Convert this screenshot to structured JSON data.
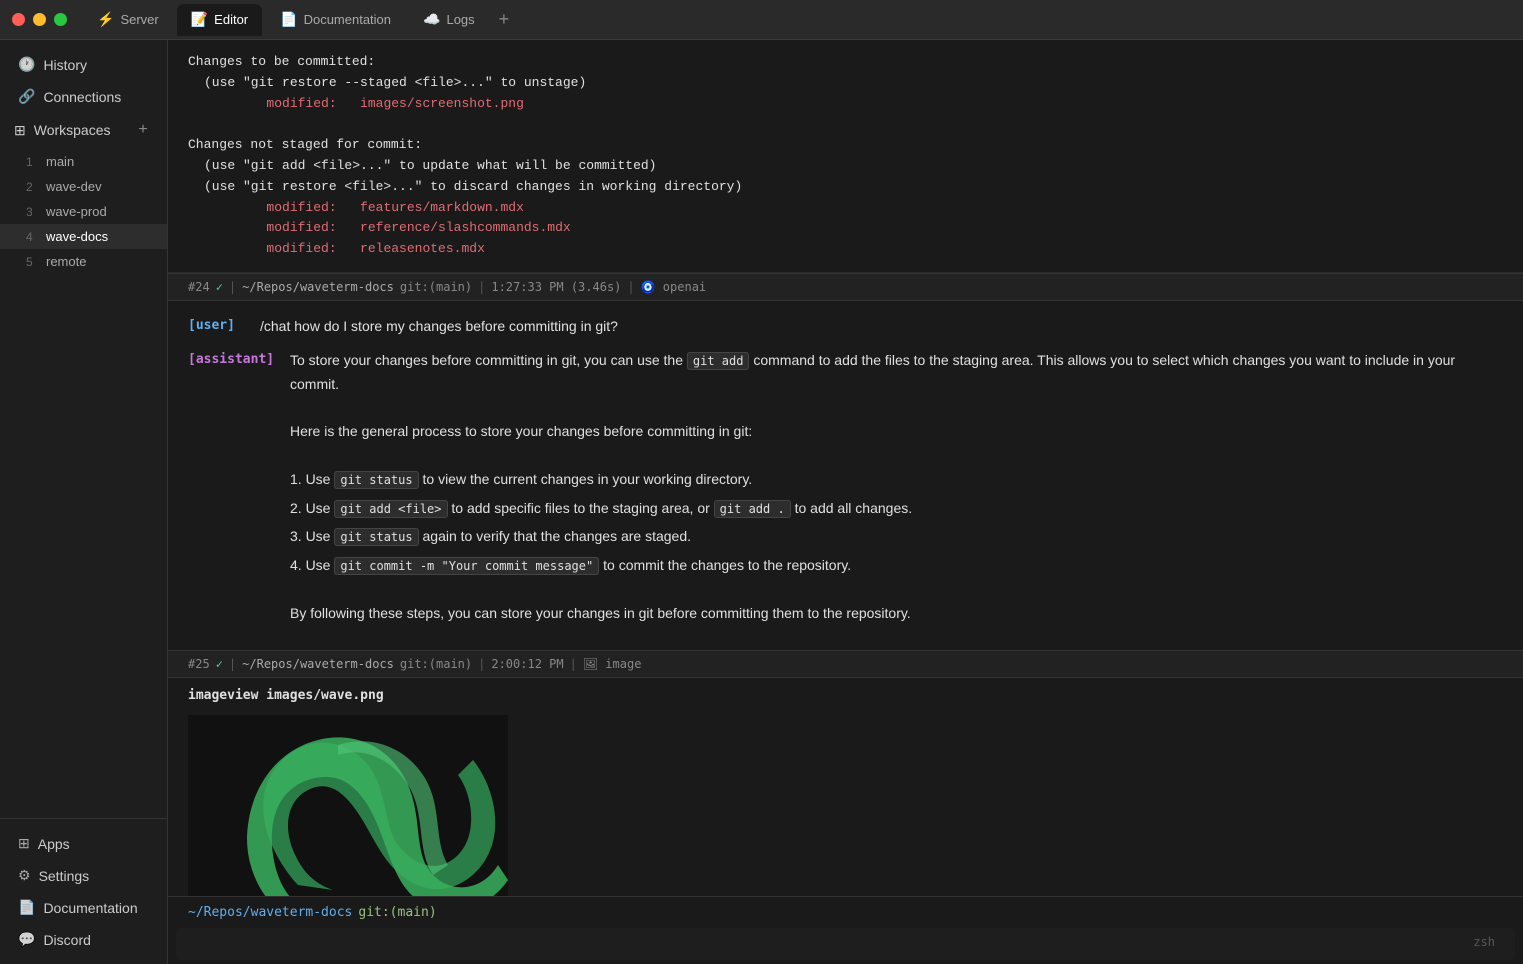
{
  "titlebar": {
    "tabs": [
      {
        "id": "server",
        "label": "Server",
        "icon": "⚡",
        "active": false
      },
      {
        "id": "editor",
        "label": "Editor",
        "icon": "📝",
        "active": true
      },
      {
        "id": "documentation",
        "label": "Documentation",
        "icon": "📄",
        "active": false
      },
      {
        "id": "logs",
        "label": "Logs",
        "icon": "☁️",
        "active": false
      }
    ],
    "add_tab": "+"
  },
  "sidebar": {
    "history_label": "History",
    "connections_label": "Connections",
    "workspaces_label": "Workspaces",
    "workspace_entries": [
      {
        "num": "1",
        "name": "main"
      },
      {
        "num": "2",
        "name": "wave-dev"
      },
      {
        "num": "3",
        "name": "wave-prod"
      },
      {
        "num": "4",
        "name": "wave-docs",
        "active": true
      },
      {
        "num": "5",
        "name": "remote"
      }
    ],
    "bottom_items": [
      {
        "id": "apps",
        "label": "Apps",
        "icon": "⊞"
      },
      {
        "id": "settings",
        "label": "Settings",
        "icon": "⚙"
      },
      {
        "id": "documentation",
        "label": "Documentation",
        "icon": "📄"
      },
      {
        "id": "discord",
        "label": "Discord",
        "icon": "💬"
      }
    ]
  },
  "terminal": {
    "block_24": {
      "prompt": "#24 ✓  |  ~/Repos/waveterm-docs  git:(main)  |  1:27:33 PM (3.46s)  |  🧿 openai",
      "git_output_lines": [
        "Changes to be committed:",
        "  (use \"git restore --staged <file>...\" to unstage)",
        "          modified:   images/screenshot.png",
        "",
        "Changes not staged for commit:",
        "  (use \"git add <file>...\" to update what will be committed)",
        "  (use \"git restore <file>...\" to discard changes in working directory)",
        "          modified:   features/markdown.mdx",
        "          modified:   reference/slashcommands.mdx",
        "          modified:   releasenotes.mdx"
      ],
      "red_files": [
        "images/screenshot.png",
        "features/markdown.mdx",
        "reference/slashcommands.mdx",
        "releasenotes.mdx"
      ],
      "chat_user": "[user]",
      "chat_user_cmd": "/chat how do I store my changes before committing in git?",
      "chat_assistant": "[assistant]",
      "chat_reply_1": "To store your changes before committing in git, you can use the",
      "inline_code_1": "git add",
      "chat_reply_2": "command to add the files to the staging area. This allows you to select which changes you want to include in your commit.",
      "chat_intro": "Here is the general process to store your changes before committing in git:",
      "chat_steps": [
        {
          "num": "1.",
          "text": "Use ",
          "code": "git status",
          "rest": " to view the current changes in your working directory."
        },
        {
          "num": "2.",
          "text": "Use ",
          "code": "git add <file>",
          "rest": " to add specific files to the staging area, or ",
          "code2": "git add .",
          "rest2": " to add all changes."
        },
        {
          "num": "3.",
          "text": "Use ",
          "code": "git status",
          "rest": " again to verify that the changes are staged."
        },
        {
          "num": "4.",
          "text": "Use ",
          "code": "git commit -m \"Your commit message\"",
          "rest": " to commit the changes to the repository."
        }
      ],
      "chat_footer": "By following these steps, you can store your changes in git before committing them to the repository."
    },
    "block_25": {
      "prompt": "#25 ✓  |  ~/Repos/waveterm-docs  git:(main)  |  2:00:12 PM  |  🖼 image",
      "command": "imageview images/wave.png"
    },
    "shell_prompt": "~/Repos/waveterm-docs  git:(main)",
    "shell_cwd": "~/Repos/waveterm-docs",
    "shell_branch": "git:(main)",
    "zsh_label": "zsh"
  },
  "colors": {
    "accent_blue": "#61afef",
    "accent_green": "#98c379",
    "accent_red": "#e06c75",
    "accent_purple": "#c678dd",
    "bg_dark": "#1a1a1a",
    "bg_medium": "#1e1e1e",
    "bg_sidebar": "#2a2a2a"
  }
}
